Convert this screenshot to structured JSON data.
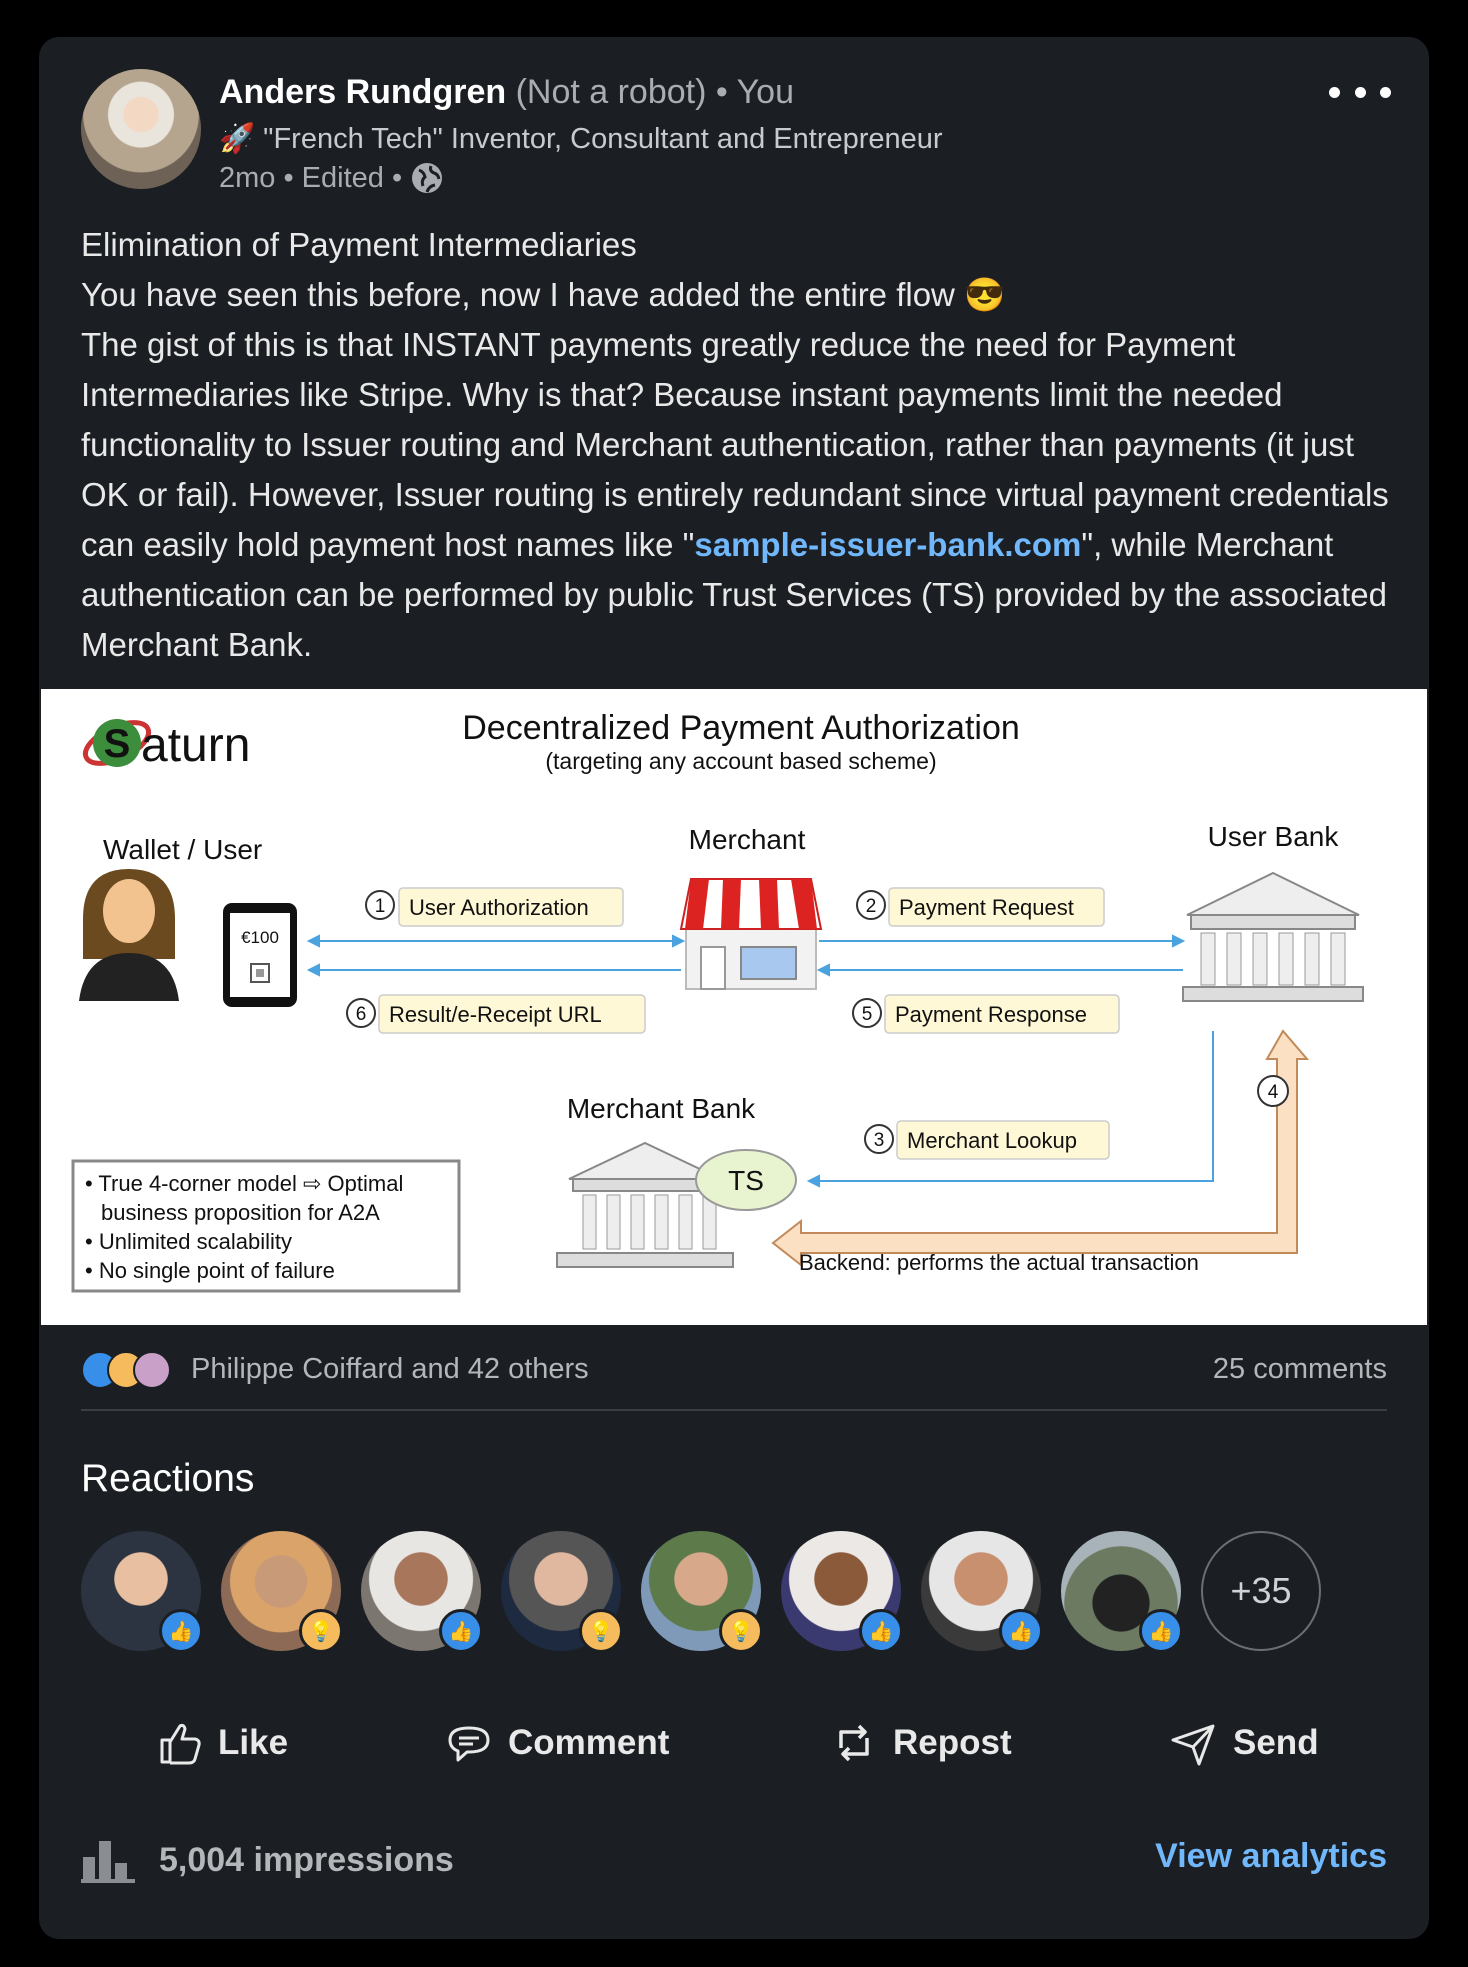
{
  "post": {
    "author": {
      "name": "Anders Rundgren",
      "tag": "(Not a robot)",
      "relation": "• You",
      "headline": "\"French Tech\" Inventor, Consultant and Entrepreneur",
      "headline_icon": "rocket-icon",
      "time": "2mo • Edited •",
      "visibility_icon": "globe-icon"
    },
    "more_icon": "more-dots-icon",
    "text": {
      "line1": "Elimination of Payment Intermediaries",
      "line2": "You have seen this before, now I have added the entire flow",
      "line2_emoji": "😎",
      "para_before_link": "The gist of this is that INSTANT payments greatly reduce the need for Payment Intermediaries like Stripe. Why is that? Because instant payments limit the needed functionality to Issuer routing and Merchant authentication, rather than payments (it just OK or fail). However, Issuer routing is entirely redundant since virtual payment credentials can easily hold payment host names like \"",
      "link": "sample-issuer-bank.com",
      "para_after_link": "\", while Merchant authentication can be performed by public Trust Services (TS) provided by the associated Merchant Bank."
    }
  },
  "diagram": {
    "logo_letter": "S",
    "logo_text": "aturn",
    "title": "Decentralized Payment Authorization",
    "subtitle": "(targeting any account based scheme)",
    "wallet_label": "Wallet / User",
    "phone_amount": "€100",
    "merchant_label": "Merchant",
    "user_bank_label": "User Bank",
    "merchant_bank_label": "Merchant Bank",
    "ts_label": "TS",
    "steps": [
      {
        "num": "1",
        "label": "User Authorization"
      },
      {
        "num": "2",
        "label": "Payment Request"
      },
      {
        "num": "3",
        "label": "Merchant Lookup"
      },
      {
        "num": "4",
        "label": ""
      },
      {
        "num": "5",
        "label": "Payment Response"
      },
      {
        "num": "6",
        "label": "Result/e-Receipt URL"
      }
    ],
    "features": [
      "• True 4-corner model ⇨ Optimal",
      "business proposition for A2A",
      "• Unlimited scalability",
      "• No single point of failure"
    ],
    "backend_label": "Backend: performs the actual transaction"
  },
  "social": {
    "reactors_text": "Philippe Coiffard and 42 others",
    "comments": "25 comments",
    "reaction_icons": [
      "like-icon",
      "insightful-icon",
      "love-icon"
    ],
    "colors": {
      "like": "#378fe9",
      "insightful": "#f5bb5c",
      "love": "#df704d"
    }
  },
  "reactions": {
    "title": "Reactions",
    "people": [
      {
        "badge": "like",
        "badge_icon": "like-icon"
      },
      {
        "badge": "insight",
        "badge_icon": "insightful-icon"
      },
      {
        "badge": "like",
        "badge_icon": "like-icon"
      },
      {
        "badge": "insight",
        "badge_icon": "insightful-icon"
      },
      {
        "badge": "insight",
        "badge_icon": "insightful-icon"
      },
      {
        "badge": "like",
        "badge_icon": "like-icon"
      },
      {
        "badge": "like",
        "badge_icon": "like-icon"
      },
      {
        "badge": "like",
        "badge_icon": "like-icon"
      }
    ],
    "more": "+35"
  },
  "actions": {
    "like": "Like",
    "comment": "Comment",
    "repost": "Repost",
    "send": "Send"
  },
  "footer": {
    "impressions": "5,004 impressions",
    "analytics_link": "View analytics",
    "analytics_icon": "bar-chart-icon"
  },
  "theme": {
    "card_bg": "#1b1f23",
    "link": "#71b7fb",
    "text": "#e9e9e9"
  }
}
